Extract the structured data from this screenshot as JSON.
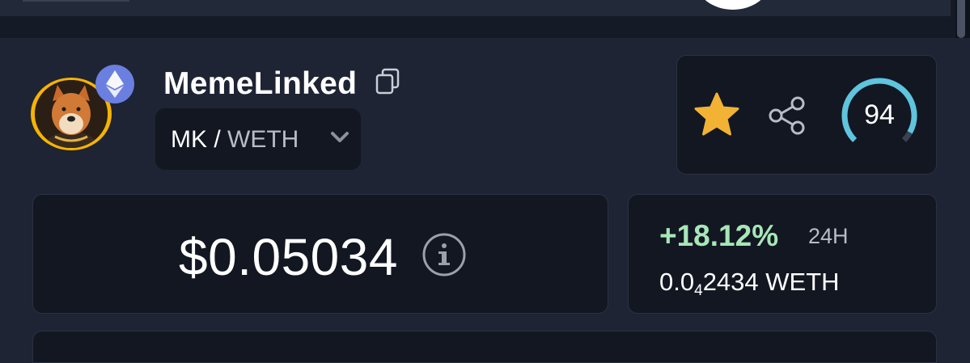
{
  "token": {
    "name": "MemeLinked",
    "pair_base": "MK",
    "pair_separator": " / ",
    "pair_quote": "WETH",
    "chain_icon": "ethereum-icon"
  },
  "actions": {
    "favorite_icon": "star-icon",
    "share_icon": "share-icon",
    "score": "94",
    "score_fraction": 0.94
  },
  "price": {
    "usd": "$0.05034",
    "info_icon": "info-icon"
  },
  "change": {
    "percent": "+18.12%",
    "period": "24H",
    "weth_prefix": "0.0",
    "weth_zero_count": "4",
    "weth_digits": "2434",
    "weth_unit": " WETH"
  },
  "colors": {
    "positive": "#a8e6b8",
    "gauge": "#5fc4dd",
    "star": "#f2b234",
    "badge": "#6b7fe0"
  }
}
